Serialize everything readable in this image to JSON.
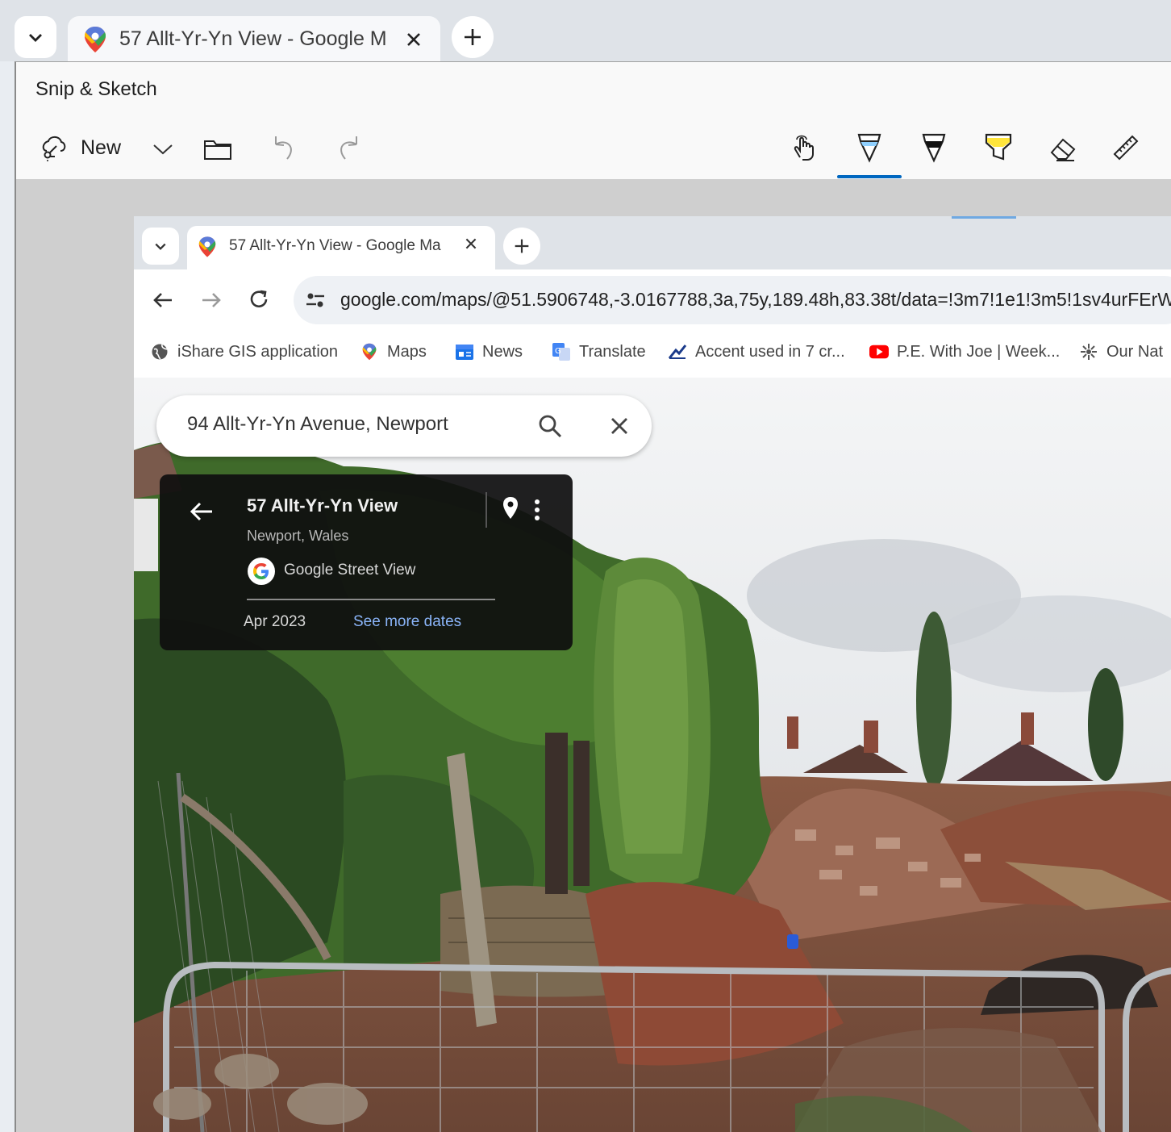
{
  "outer_browser": {
    "tab_title": "57 Allt-Yr-Yn View - Google Ma"
  },
  "snip_app": {
    "title": "Snip & Sketch",
    "new_label": "New",
    "accent_color": "#0067c0"
  },
  "inner_browser": {
    "tab_title": "57 Allt-Yr-Yn View - Google Ma",
    "url": "google.com/maps/@51.5906748,-3.0167788,3a,75y,189.48h,83.38t/data=!3m7!1e1!3m5!1sv4urFErW",
    "bookmarks": [
      {
        "label": "iShare GIS application",
        "icon": "globe-icon"
      },
      {
        "label": "Maps",
        "icon": "maps-pin-icon"
      },
      {
        "label": "News",
        "icon": "news-icon"
      },
      {
        "label": "Translate",
        "icon": "translate-icon"
      },
      {
        "label": "Accent used in 7 cr...",
        "icon": "chart-icon"
      },
      {
        "label": "P.E. With Joe | Week...",
        "icon": "youtube-icon"
      },
      {
        "label": "Our Nat",
        "icon": "nature-icon"
      }
    ]
  },
  "maps": {
    "search_value": "94 Allt-Yr-Yn Avenue, Newport",
    "place_title": "57 Allt-Yr-Yn View",
    "place_subtitle": "Newport, Wales",
    "source": "Google Street View",
    "date": "Apr 2023",
    "more_dates": "See more dates"
  }
}
